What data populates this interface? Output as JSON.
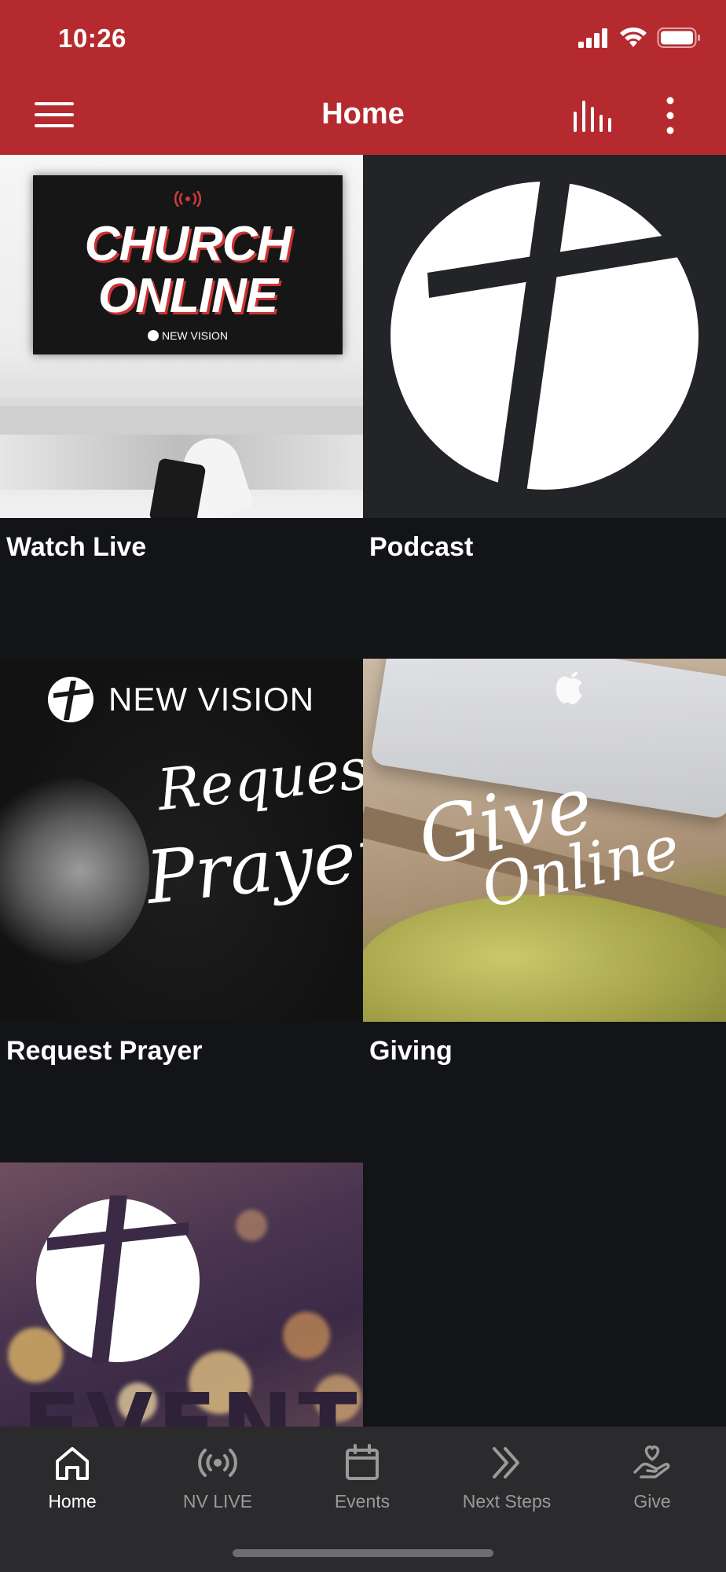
{
  "status_bar": {
    "time": "10:26"
  },
  "header": {
    "title": "Home",
    "background": "#b52a2e"
  },
  "tiles": [
    {
      "label": "Watch Live",
      "art": {
        "badge": "CHURCH ONLINE",
        "line1": "CHURCH",
        "line2": "ONLINE",
        "brand": "NEW VISION"
      }
    },
    {
      "label": "Podcast"
    },
    {
      "label": "Request Prayer",
      "art": {
        "brand": "NEW VISION",
        "script1": "Request",
        "script2": "Prayer"
      }
    },
    {
      "label": "Giving",
      "art": {
        "script1": "Give",
        "script2": "Online"
      }
    },
    {
      "label": "",
      "art": {
        "word": "EVENTS"
      }
    }
  ],
  "bottom_nav": {
    "items": [
      {
        "label": "Home",
        "icon": "home-icon",
        "active": true
      },
      {
        "label": "NV LIVE",
        "icon": "broadcast-icon",
        "active": false
      },
      {
        "label": "Events",
        "icon": "calendar-icon",
        "active": false
      },
      {
        "label": "Next Steps",
        "icon": "double-chevron-icon",
        "active": false
      },
      {
        "label": "Give",
        "icon": "hand-heart-icon",
        "active": false
      }
    ]
  }
}
